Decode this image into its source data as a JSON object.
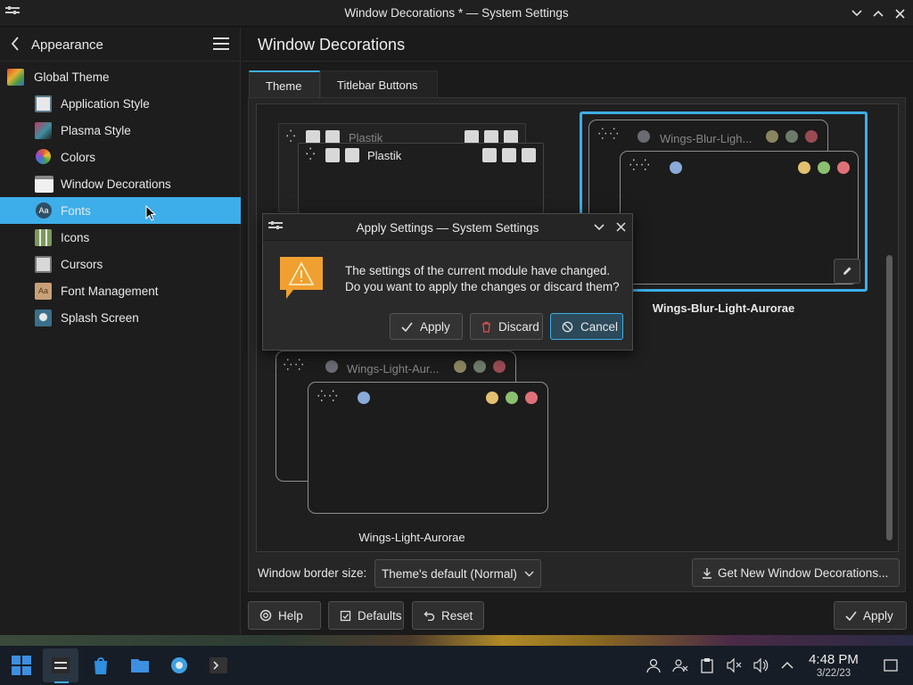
{
  "window": {
    "title": "Window Decorations * — System Settings",
    "icons": {
      "app": "settings-app-icon",
      "minimize": "chevron-down-icon",
      "maximize": "chevron-up-icon",
      "close": "close-icon"
    }
  },
  "sidebar": {
    "back_label": "Appearance",
    "items": [
      {
        "label": "Global Theme",
        "icon": "global-theme-icon",
        "color": "#c9502e"
      },
      {
        "label": "Application Style",
        "icon": "application-style-icon",
        "color": "#5d7a8d"
      },
      {
        "label": "Plasma Style",
        "icon": "plasma-style-icon",
        "color": "#3c8fa0"
      },
      {
        "label": "Colors",
        "icon": "colors-icon",
        "color": "#e05a2b"
      },
      {
        "label": "Window Decorations",
        "icon": "window-decorations-icon",
        "color": "#cfcfcf"
      },
      {
        "label": "Fonts",
        "icon": "fonts-icon",
        "color": "#2f4f66"
      },
      {
        "label": "Icons",
        "icon": "icons-icon",
        "color": "#7a9a5a"
      },
      {
        "label": "Cursors",
        "icon": "cursors-icon",
        "color": "#888888"
      },
      {
        "label": "Font Management",
        "icon": "font-management-icon",
        "color": "#a36a3a"
      },
      {
        "label": "Splash Screen",
        "icon": "splash-screen-icon",
        "color": "#3a6f8a"
      }
    ],
    "selected_index": 5
  },
  "main": {
    "title": "Window Decorations",
    "tabs": [
      {
        "label": "Theme",
        "active": true
      },
      {
        "label": "Titlebar Buttons",
        "active": false
      }
    ],
    "themes": [
      {
        "name": "Plastik",
        "title": "Plastik"
      },
      {
        "name": "Wings-Blur-Light-Aurorae",
        "title": "Wings-Blur-Ligh...",
        "selected": true
      },
      {
        "name": "Wings-Light-Aurorae",
        "title": "Wings-Light-Aur..."
      }
    ],
    "border_size_label": "Window border size:",
    "border_size_value": "Theme's default (Normal)",
    "get_new_label": "Get New Window Decorations..."
  },
  "footer": {
    "help": "Help",
    "defaults": "Defaults",
    "reset": "Reset",
    "apply": "Apply"
  },
  "dialog": {
    "title": "Apply Settings — System Settings",
    "line1": "The settings of the current module have changed.",
    "line2": "Do you want to apply the changes or discard them?",
    "apply": "Apply",
    "discard": "Discard",
    "cancel": "Cancel"
  },
  "taskbar": {
    "time": "4:48 PM",
    "date": "3/22/23",
    "apps": [
      "start-menu-icon",
      "system-settings-icon",
      "discover-icon",
      "file-manager-icon",
      "settings-gear-icon",
      "terminal-icon"
    ],
    "tray": [
      "user-icon",
      "users-icon",
      "clipboard-icon",
      "mute-icon",
      "volume-icon",
      "chevron-up-icon",
      "show-desktop-icon"
    ]
  },
  "colors": {
    "accent": "#3daee9",
    "background": "#1b1b1b"
  }
}
